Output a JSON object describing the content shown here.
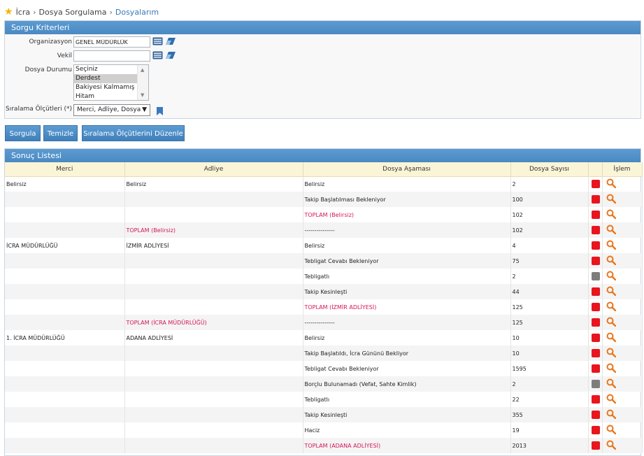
{
  "breadcrumb": {
    "items": [
      "İcra",
      "Dosya Sorgulama",
      "Dosyalarım"
    ]
  },
  "criteria": {
    "title": "Sorgu Kriterleri",
    "organizasyon_label": "Organizasyon",
    "organizasyon_value": "GENEL MÜDÜRLÜK",
    "vekil_label": "Vekil",
    "vekil_value": "",
    "dosya_durumu_label": "Dosya Durumu",
    "dosya_durumu_options": [
      "Seçiniz",
      "Derdest",
      "Bakiyesi Kalmamış",
      "Hitam"
    ],
    "dosya_durumu_selected": "Derdest",
    "siralama_label": "Sıralama Ölçütleri (*)",
    "siralama_value": "Merci, Adliye, Dosya"
  },
  "buttons": {
    "sorgula": "Sorgula",
    "temizle": "Temizle",
    "siralama_duzenle": "Sıralama Ölçütlerini Düzenle"
  },
  "results": {
    "title": "Sonuç Listesi",
    "columns": [
      "Merci",
      "Adliye",
      "Dosya Aşaması",
      "Dosya Sayısı",
      "",
      "İşlem"
    ],
    "rows": [
      {
        "merci": "Belirsiz",
        "adliye": "Belirsiz",
        "asama": "Belirsiz",
        "sayi": "2",
        "status": "red",
        "merci_total": false,
        "adliye_total": false,
        "asama_total": false
      },
      {
        "merci": "",
        "adliye": "",
        "asama": "Takip Başlatılması Bekleniyor",
        "sayi": "100",
        "status": "red",
        "merci_total": false,
        "adliye_total": false,
        "asama_total": false
      },
      {
        "merci": "",
        "adliye": "",
        "asama": "TOPLAM (Belirsiz)",
        "sayi": "102",
        "status": "red",
        "merci_total": false,
        "adliye_total": false,
        "asama_total": true
      },
      {
        "merci": "",
        "adliye": "TOPLAM (Belirsiz)",
        "asama": "---------------",
        "sayi": "102",
        "status": "red",
        "merci_total": false,
        "adliye_total": true,
        "asama_total": false
      },
      {
        "merci": "İCRA MÜDÜRLÜĞÜ",
        "adliye": "İZMİR ADLİYESİ",
        "asama": "Belirsiz",
        "sayi": "4",
        "status": "red",
        "merci_total": false,
        "adliye_total": false,
        "asama_total": false
      },
      {
        "merci": "",
        "adliye": "",
        "asama": "Tebligat Cevabı Bekleniyor",
        "sayi": "75",
        "status": "red",
        "merci_total": false,
        "adliye_total": false,
        "asama_total": false
      },
      {
        "merci": "",
        "adliye": "",
        "asama": "Tebligatlı",
        "sayi": "2",
        "status": "gray",
        "merci_total": false,
        "adliye_total": false,
        "asama_total": false
      },
      {
        "merci": "",
        "adliye": "",
        "asama": "Takip Kesinleşti",
        "sayi": "44",
        "status": "red",
        "merci_total": false,
        "adliye_total": false,
        "asama_total": false
      },
      {
        "merci": "",
        "adliye": "",
        "asama": "TOPLAM (İZMİR ADLİYESİ)",
        "sayi": "125",
        "status": "red",
        "merci_total": false,
        "adliye_total": false,
        "asama_total": true
      },
      {
        "merci": "",
        "adliye": "TOPLAM (İCRA MÜDÜRLÜĞÜ)",
        "asama": "---------------",
        "sayi": "125",
        "status": "red",
        "merci_total": false,
        "adliye_total": true,
        "asama_total": false
      },
      {
        "merci": "1. İCRA MÜDÜRLÜĞÜ",
        "adliye": "ADANA ADLİYESİ",
        "asama": "Belirsiz",
        "sayi": "10",
        "status": "red",
        "merci_total": false,
        "adliye_total": false,
        "asama_total": false
      },
      {
        "merci": "",
        "adliye": "",
        "asama": "Takip Başlatıldı, İcra Gününü Bekliyor",
        "sayi": "10",
        "status": "red",
        "merci_total": false,
        "adliye_total": false,
        "asama_total": false
      },
      {
        "merci": "",
        "adliye": "",
        "asama": "Tebligat Cevabı Bekleniyor",
        "sayi": "1595",
        "status": "red",
        "merci_total": false,
        "adliye_total": false,
        "asama_total": false
      },
      {
        "merci": "",
        "adliye": "",
        "asama": "Borçlu Bulunamadı (Vefat, Sahte Kimlik)",
        "sayi": "2",
        "status": "gray",
        "merci_total": false,
        "adliye_total": false,
        "asama_total": false
      },
      {
        "merci": "",
        "adliye": "",
        "asama": "Tebligatlı",
        "sayi": "22",
        "status": "red",
        "merci_total": false,
        "adliye_total": false,
        "asama_total": false
      },
      {
        "merci": "",
        "adliye": "",
        "asama": "Takip Kesinleşti",
        "sayi": "355",
        "status": "red",
        "merci_total": false,
        "adliye_total": false,
        "asama_total": false
      },
      {
        "merci": "",
        "adliye": "",
        "asama": "Haciz",
        "sayi": "19",
        "status": "red",
        "merci_total": false,
        "adliye_total": false,
        "asama_total": false
      },
      {
        "merci": "",
        "adliye": "",
        "asama": "TOPLAM (ADANA ADLİYESİ)",
        "sayi": "2013",
        "status": "red",
        "merci_total": false,
        "adliye_total": false,
        "asama_total": true
      }
    ]
  },
  "colors": {
    "accent": "#4a89c2",
    "total_text": "#d4145a",
    "status_red": "#e8141e",
    "status_gray": "#7d7d7d",
    "search_icon": "#e8761c"
  },
  "icons": {
    "breadcrumb": "star-icon",
    "list_picker": "list-icon",
    "eraser": "eraser-icon",
    "bookmark": "bookmark-icon",
    "action": "magnifier-icon"
  }
}
